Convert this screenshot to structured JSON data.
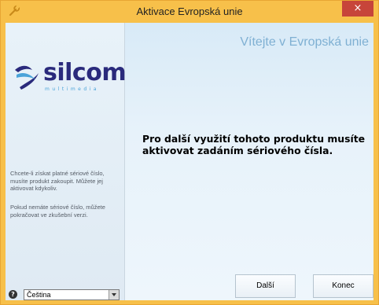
{
  "window": {
    "title": "Aktivace Evropská unie",
    "close_glyph": "×",
    "icon": "wrench-icon",
    "accent_color": "#f7c04a"
  },
  "header": {
    "welcome": "Vítejte v Evropská unie"
  },
  "logo": {
    "word": "silcom",
    "sub": "multimedia"
  },
  "main": {
    "message": "Pro další využití tohoto produktu musíte aktivovat zadáním sériového čísla."
  },
  "sidebar": {
    "info_purchase": "Chcete-li získat platné sériové číslo, musíte produkt zakoupit. Můžete jej aktivovat kdykoliv.",
    "info_trial": "Pokud nemáte sériové číslo, můžete pokračovat ve zkušební verzi."
  },
  "footer": {
    "help_glyph": "?",
    "language_value": "Čeština",
    "next_label": "Další",
    "end_label": "Konec"
  }
}
